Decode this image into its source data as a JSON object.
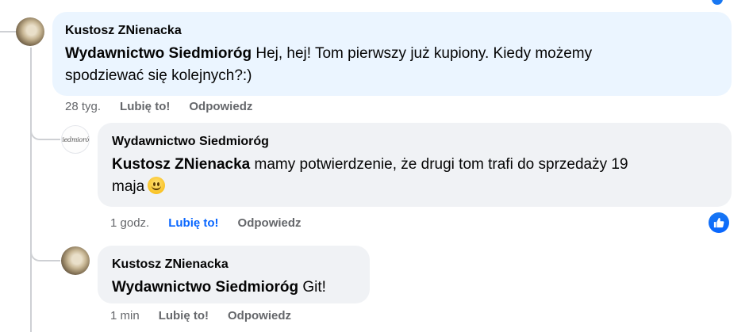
{
  "comments": [
    {
      "author": "Kustosz ZNienacka",
      "mention": "Wydawnictwo Siedmioróg",
      "text_line1": " Hej, hej! Tom pierwszy już kupiony. Kiedy możemy",
      "text_line2": "spodziewać się kolejnych?:)",
      "time": "28 tyg.",
      "like_label": "Lubię to!",
      "reply_label": "Odpowiedz"
    },
    {
      "author": "Wydawnictwo Siedmioróg",
      "avatar_text": "Siedmioróg",
      "mention": "Kustosz ZNienacka",
      "text_line1": " mamy potwierdzenie, że drugi tom trafi do sprzedaży 19",
      "text_line2": "maja",
      "emoji": "smiling-face",
      "time": "1 godz.",
      "like_label": "Lubię to!",
      "reply_label": "Odpowiedz",
      "reaction_icon": "thumbs-up"
    },
    {
      "author": "Kustosz ZNienacka",
      "mention": "Wydawnictwo Siedmioróg",
      "text": " Git!",
      "time": "1 min",
      "like_label": "Lubię to!",
      "reply_label": "Odpowiedz"
    }
  ],
  "colors": {
    "bubble_blue": "#ebf5ff",
    "bubble_grey": "#f0f2f5",
    "like_active": "#0866ff",
    "meta_text": "#65676b"
  }
}
